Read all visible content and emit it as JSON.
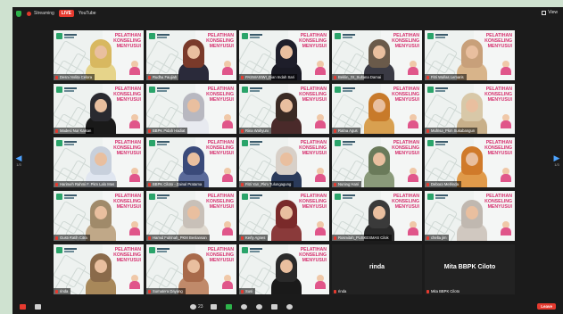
{
  "topbar": {
    "recording_label": "Streaming",
    "live_label": "LIVE",
    "youtube_label": "YouTube",
    "view_label": "View"
  },
  "pagination": {
    "left_page": "1/3",
    "right_page": "1/3"
  },
  "slogan": "PELATIHAN KONSELING MENYUSUI",
  "colors": {
    "accent_pink": "#d6316f",
    "live_red": "#e53a2f",
    "zoom_green": "#2db34a",
    "link_blue": "#4da3ff"
  },
  "tiles": [
    {
      "name": "Desni Nolita Celora"
    },
    {
      "name": "Rudha Faujiah"
    },
    {
      "name": "PASWASIWI_Dian Indah Sari"
    },
    {
      "name": "Beklin_GI_Sultana Damai"
    },
    {
      "name": "Fitri Wallas Lemaris"
    },
    {
      "name": "Madesi Nur Kaisan"
    },
    {
      "name": "BBPK Pidah Hadiat"
    },
    {
      "name": "Rina Wahyuni"
    },
    {
      "name": "Ratna Agus"
    },
    {
      "name": "Mufrisa_Pkm Sukabangun"
    },
    {
      "name": "Harimeh Rahmi F. Pkm Lalo Mas"
    },
    {
      "name": "BBPK Ciloto - Zainal Pratama"
    },
    {
      "name": "Fitri Yan_Pkm Tulungagung"
    },
    {
      "name": "Nuning Hani"
    },
    {
      "name": "Debora Melrinda"
    },
    {
      "name": "Gusti Ratih Citra"
    },
    {
      "name": "Hamid Fulrinah_PKM Benlansan"
    },
    {
      "name": "Kerly Agnes"
    },
    {
      "name": "Rosmitah_PUSKESMAS Cilok"
    },
    {
      "name": "chella jim"
    },
    {
      "name": "rinda"
    },
    {
      "name": "Sumatera Dayang"
    },
    {
      "name": "Susi"
    },
    {
      "name": "rinda",
      "big": "rinda"
    },
    {
      "name": "Mita BBPK Ciloto",
      "big": "Mita BBPK Ciloto"
    }
  ],
  "bottombar": {
    "unmute_label": "",
    "video_label": "",
    "participants_count": "23",
    "leave_label": "Leave"
  }
}
